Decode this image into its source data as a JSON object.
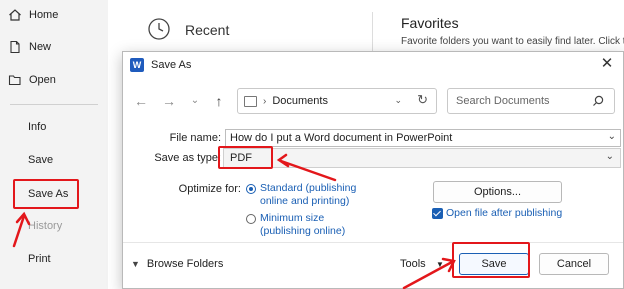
{
  "nav": {
    "home": "Home",
    "new": "New",
    "open": "Open",
    "info": "Info",
    "save": "Save",
    "save_as": "Save As",
    "history": "History",
    "print": "Print"
  },
  "backstage": {
    "recent_title": "Recent",
    "favorites_title": "Favorites",
    "favorites_subtitle": "Favorite folders you want to easily find later. Click th"
  },
  "dialog": {
    "title": "Save As",
    "address_folder": "Documents",
    "search_placeholder": "Search Documents",
    "file_name_label": "File name:",
    "file_name_value": "How do I put a Word document in PowerPoint",
    "save_as_type_label": "Save as type:",
    "save_as_type_value": "PDF",
    "optimize_label": "Optimize for:",
    "optimize_standard": "Standard (publishing online and printing)",
    "optimize_minimum": "Minimum size (publishing online)",
    "options_button": "Options...",
    "open_after_publishing": "Open file after publishing",
    "browse_folders": "Browse Folders",
    "tools": "Tools",
    "save_button": "Save",
    "cancel_button": "Cancel"
  },
  "colors": {
    "accent": "#1a5fb4",
    "annotation": "#e3171b",
    "word_blue": "#1f5bbd"
  }
}
